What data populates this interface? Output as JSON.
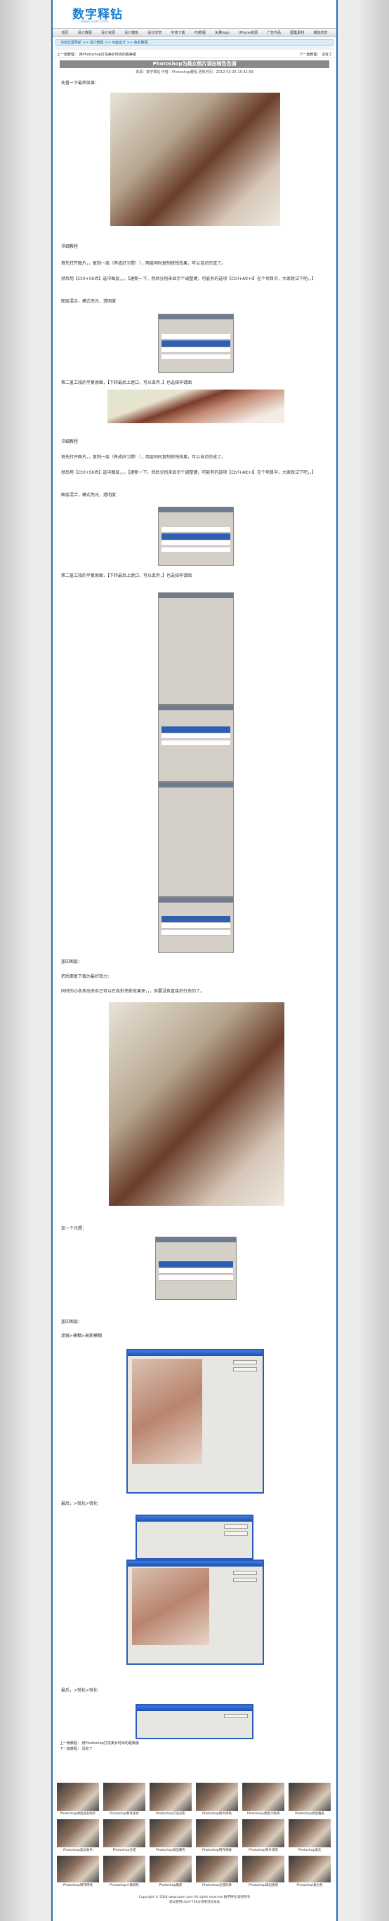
{
  "site": {
    "logo": "数字释钻",
    "logo_url": "www.szxm.com"
  },
  "nav": [
    "首页",
    "设计教程",
    "设计资源",
    "设计模板",
    "设计欣赏",
    "字体下载",
    "PS教程",
    "矢量logo",
    "iPhone资源",
    "广告作品",
    "图集素材",
    "播放欣赏"
  ],
  "subnav": "当前位置导航 >> 设计教程 >> 平面设计 >> 色彩教程",
  "breadcrumb": {
    "left": "上一篇教程： 用Photoshop打造美女时尚的甜美版",
    "right": "下一篇教程： 没有了"
  },
  "article": {
    "title": "Photoshop为美女照片调出暗色色调",
    "meta": "来源：数字释钻   作者：Photoshop教程   更新时间：2012-03-26 15:42:58",
    "intro": "先看一下最终效果：",
    "steps": [
      "详细教程",
      "首先打开图片，，复制一层（养成好习惯！），两层同时复制修残效果，可以自动完成了。",
      "然后用【Ctrl+Shift】选中图层，，，【建新一下，然后分别来显示个调整键，可能有的选项【Ctrl+Alt+I】在个项目中，大家就试下吧，，】",
      "图层混合，模式亮光，透明度",
      "第二盖工段的平复原图，【下转最后上遮口，可以丢弃，】也选择申请图",
      "详细教程",
      "首先打开图片，，复制一层（养成好习惯！），两层同时复制修残效果，可以自动完成了。",
      "然后用【Ctrl+Shift】选中图层，，，【建新一下，然后分别来显示个调整键，可能有的选项【Ctrl+Alt+I】在个项目中，大家就试下吧，，】",
      "图层混合，模式亮光，透明度",
      "第二盖工段的平复原图，【下转最后上遮口，可以丢弃，】也选择申请图",
      "盖印图层：",
      "把后面复下载为最好效力：",
      "同时的小色差出去自己可以在色彩亮影效果来，，，但要没有直接后行去的了。",
      "加一个光照：",
      "盖印图层：",
      "滤镜>模糊>高斯模糊",
      "最后，>锐化>锐化",
      "最后，>锐化>锐化"
    ]
  },
  "bottom_links": [
    "上一篇教程： 用Photoshop打造美女时尚的甜美版",
    "下一篇教程： 没有了"
  ],
  "thumbs": [
    "Photoshop调出美女照片",
    "Photoshop制作美女",
    "Photoshop打造光影",
    "Photoshop照片调色",
    "Photoshop调出冷色调",
    "Photoshop调出唯美",
    "Photoshop美女肤色",
    "Photoshop合成",
    "Photoshop调出暖色",
    "Photoshop制作海报",
    "Photoshop照片修饰",
    "Photoshop美化",
    "Photoshop制作特效",
    "Photoshop人像调色",
    "Photoshop磨皮",
    "Photoshop合成效果",
    "Photoshop调出质感",
    "Photoshop复古色"
  ],
  "footer": [
    "Copyright © 2008 www.szxm.com All rights reserved 数字释钻 版权所有",
    "建议使用1024*768分辨率浏览本站"
  ]
}
